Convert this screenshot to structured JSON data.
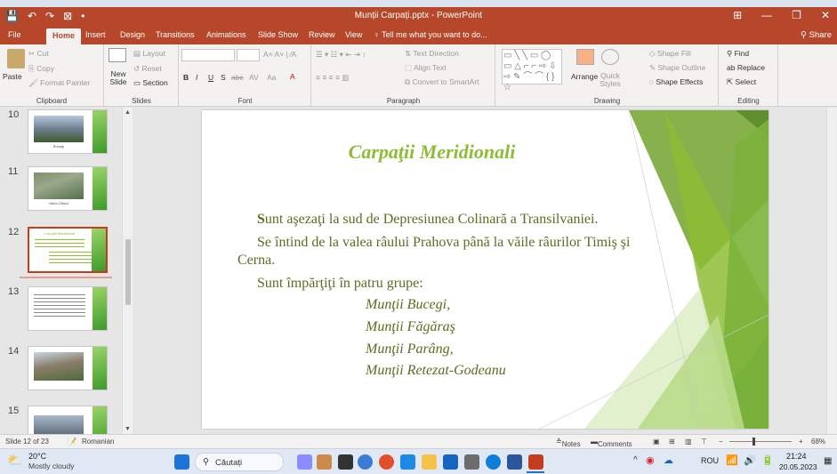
{
  "window": {
    "title": "Munții Carpați.pptx - PowerPoint",
    "qat": [
      "💾",
      "↶",
      "↷",
      "⊠",
      "•"
    ]
  },
  "tabs": [
    "File",
    "Home",
    "Insert",
    "Design",
    "Transitions",
    "Animations",
    "Slide Show",
    "Review",
    "View"
  ],
  "tell_me": "Tell me what you want to do...",
  "share": "Share",
  "ribbon": {
    "clipboard": {
      "label": "Clipboard",
      "paste": "Paste",
      "cut": "Cut",
      "copy": "Copy",
      "format_painter": "Format Painter"
    },
    "slides": {
      "label": "Slides",
      "new_slide": "New Slide",
      "layout": "Layout",
      "reset": "Reset",
      "section": "Section"
    },
    "font": {
      "label": "Font",
      "bold": "B",
      "italic": "I",
      "underline": "U",
      "strike": "S",
      "abc": "abc",
      "av": "AV",
      "aa": "Aa"
    },
    "paragraph": {
      "label": "Paragraph",
      "text_direction": "Text Direction",
      "align_text": "Align Text",
      "smartart": "Convert to SmartArt"
    },
    "drawing": {
      "label": "Drawing",
      "arrange": "Arrange",
      "quick_styles": "Quick Styles",
      "shape_fill": "Shape Fill",
      "shape_outline": "Shape Outline",
      "shape_effects": "Shape Effects"
    },
    "editing": {
      "label": "Editing",
      "find": "Find",
      "replace": "Replace",
      "select": "Select"
    }
  },
  "thumbnails": [
    {
      "num": "10",
      "caption": "Bucegi"
    },
    {
      "num": "11",
      "caption": "Valea Oltului"
    },
    {
      "num": "12",
      "caption": "Carpații Meridionali"
    },
    {
      "num": "13",
      "caption": ""
    },
    {
      "num": "14",
      "caption": ""
    },
    {
      "num": "15",
      "caption": ""
    }
  ],
  "slide": {
    "title": "Carpaţii Meridionali",
    "line1_bold": "S",
    "line1_rest": "unt aşezaţi la sud de Depresiunea Colinară a Transilvaniei.",
    "line2": "Se întind de la valea râului Prahova până la văile râurilor Timiş şi",
    "line2b": "Cerna.",
    "line3": "Sunt împărţiţi în patru grupe:",
    "groups": [
      "Munţii Bucegi,",
      "Munţii Făgăraş",
      "Munţii Parâng,",
      "Munţii Retezat-Godeanu"
    ]
  },
  "status": {
    "slide_info": "Slide 12 of 23",
    "language": "Romanian",
    "notes": "Notes",
    "comments": "Comments",
    "zoom": "68%"
  },
  "taskbar": {
    "weather_temp": "20°C",
    "weather_desc": "Mostly cloudy",
    "search": "Căutați",
    "lang": "ROU",
    "time": "21:24",
    "date": "20.05.2023"
  },
  "colors": {
    "ppt_accent": "#b7472a",
    "slide_green": "#8ebd35",
    "text_olive": "#5a6e1f"
  }
}
